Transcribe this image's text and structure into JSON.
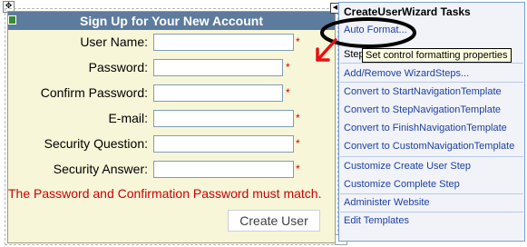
{
  "wizard": {
    "title": "Sign Up for Your New Account",
    "fields": [
      {
        "label": "User Name:",
        "required": "*"
      },
      {
        "label": "Password:",
        "required": "*"
      },
      {
        "label": "Confirm Password:",
        "required": "*"
      },
      {
        "label": "E-mail:",
        "required": "*"
      },
      {
        "label": "Security Question:",
        "required": "*"
      },
      {
        "label": "Security Answer:",
        "required": "*"
      }
    ],
    "error": "The Password and Confirmation Password must match.",
    "create_button": "Create User"
  },
  "tasks": {
    "header": "CreateUserWizard Tasks",
    "auto_format": "Auto Format...",
    "step_label": "Step",
    "add_remove": "Add/Remove WizardSteps...",
    "convert_start": "Convert to StartNavigationTemplate",
    "convert_step": "Convert to StepNavigationTemplate",
    "convert_finish": "Convert to FinishNavigationTemplate",
    "convert_custom": "Convert to CustomNavigationTemplate",
    "customize_create": "Customize Create User Step",
    "customize_complete": "Customize Complete Step",
    "administer": "Administer Website",
    "edit_templates": "Edit Templates"
  },
  "tooltip": "Set control formatting properties",
  "icons": {
    "move_handle": "move-arrows-icon",
    "smart_tag": "smart-tag-arrow-icon"
  },
  "colors": {
    "title_bar": "#5d7b9d",
    "wizard_bg": "#f7f6d8",
    "error": "#cc0000",
    "link": "#1c3fa5"
  }
}
